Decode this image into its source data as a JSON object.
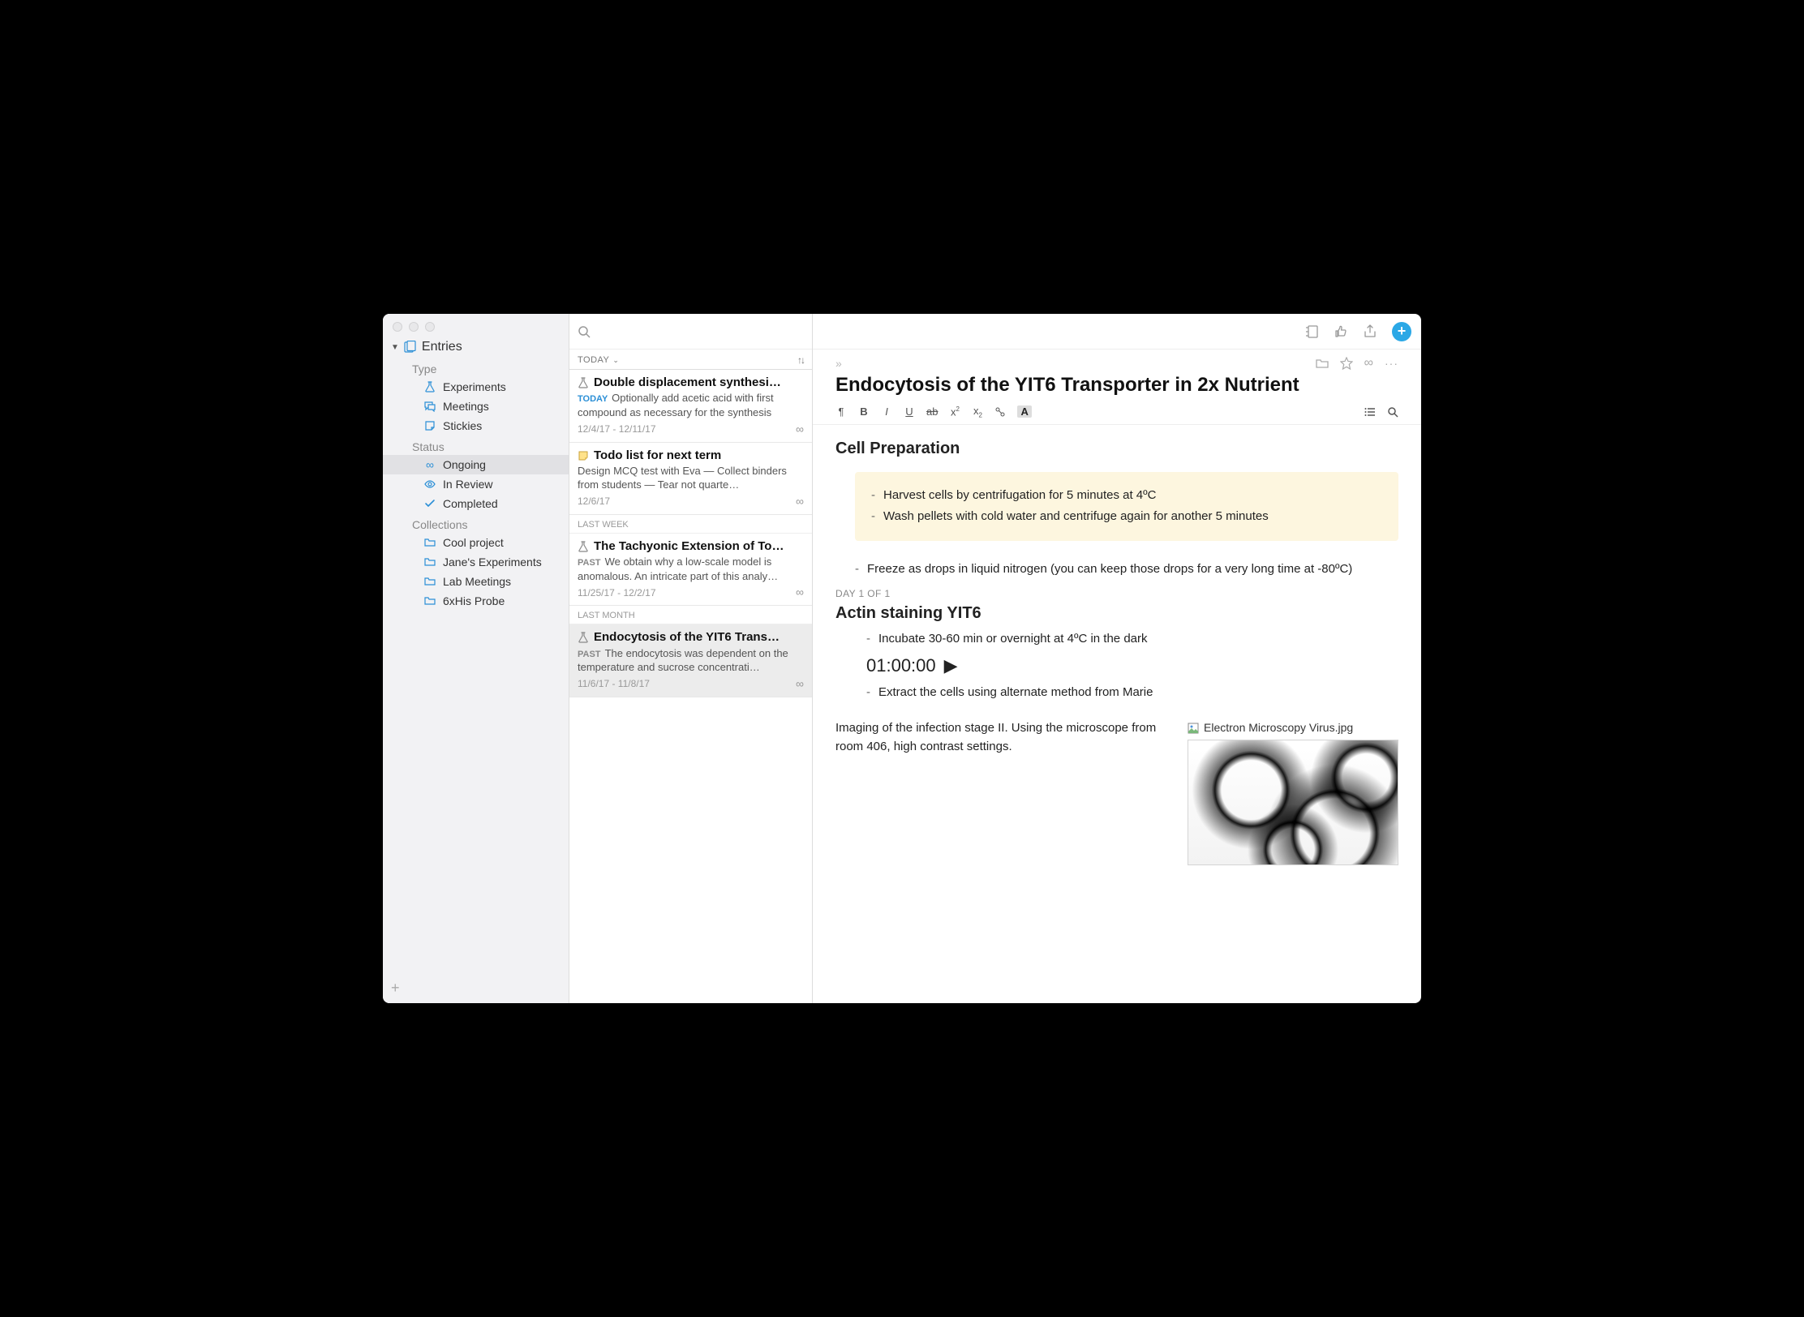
{
  "sidebar": {
    "root": "Entries",
    "groups": [
      {
        "label": "Type",
        "items": [
          {
            "label": "Experiments",
            "icon": "flask"
          },
          {
            "label": "Meetings",
            "icon": "chat"
          },
          {
            "label": "Stickies",
            "icon": "sticky"
          }
        ]
      },
      {
        "label": "Status",
        "items": [
          {
            "label": "Ongoing",
            "icon": "infinity",
            "active": true
          },
          {
            "label": "In Review",
            "icon": "eye"
          },
          {
            "label": "Completed",
            "icon": "check"
          }
        ]
      },
      {
        "label": "Collections",
        "items": [
          {
            "label": "Cool project",
            "icon": "folder"
          },
          {
            "label": "Jane's Experiments",
            "icon": "folder"
          },
          {
            "label": "Lab Meetings",
            "icon": "folder"
          },
          {
            "label": "6xHis Probe",
            "icon": "folder"
          }
        ]
      }
    ]
  },
  "list": {
    "sort_label": "TODAY",
    "groups": [
      {
        "label": null,
        "entries": [
          {
            "icon": "flask",
            "title": "Double displacement synthesi…",
            "badge": "TODAY",
            "badge_class": "today",
            "excerpt": "Optionally add acetic acid with first compound as necessary for the synthesis",
            "date": "12/4/17 - 12/11/17",
            "infinity": true,
            "selected": false
          },
          {
            "icon": "sticky-yellow",
            "title": "Todo list for next term",
            "badge": null,
            "excerpt": "Design MCQ test with Eva — Collect binders from students — Tear not quarte…",
            "date": "12/6/17",
            "infinity": true,
            "selected": false
          }
        ]
      },
      {
        "label": "LAST WEEK",
        "entries": [
          {
            "icon": "flask",
            "title": "The Tachyonic Extension of To…",
            "badge": "PAST",
            "badge_class": "past",
            "excerpt": "We obtain why a low-scale model is anomalous. An intricate part of this analy…",
            "date": "11/25/17 - 12/2/17",
            "infinity": true,
            "selected": false
          }
        ]
      },
      {
        "label": "LAST MONTH",
        "entries": [
          {
            "icon": "flask",
            "title": "Endocytosis of the YIT6 Trans…",
            "badge": "PAST",
            "badge_class": "past",
            "excerpt": "The endocytosis was dependent on the temperature and sucrose concentrati…",
            "date": "11/6/17 - 11/8/17",
            "infinity": true,
            "selected": true
          }
        ]
      }
    ]
  },
  "detail": {
    "title": "Endocytosis of the YIT6 Transporter in 2x Nutrient",
    "section1": "Cell Preparation",
    "callout1": "Harvest cells by centrifugation for 5 minutes at 4ºC",
    "callout2": "Wash pellets with cold water and centrifuge again for another 5 minutes",
    "bullet_freeze": "Freeze as drops in liquid nitrogen (you can keep those drops for a very long time at -80ºC)",
    "day_label": "DAY 1 of 1",
    "section2": "Actin staining YIT6",
    "bullet_incubate": "Incubate 30-60 min or overnight at 4ºC in the dark",
    "timer": "01:00:00",
    "bullet_extract": "Extract the cells using alternate method from Marie",
    "imaging_note": "Imaging of the infection stage II. Using the microscope from room 406, high contrast settings.",
    "attachment": "Electron Microscopy Virus.jpg"
  }
}
